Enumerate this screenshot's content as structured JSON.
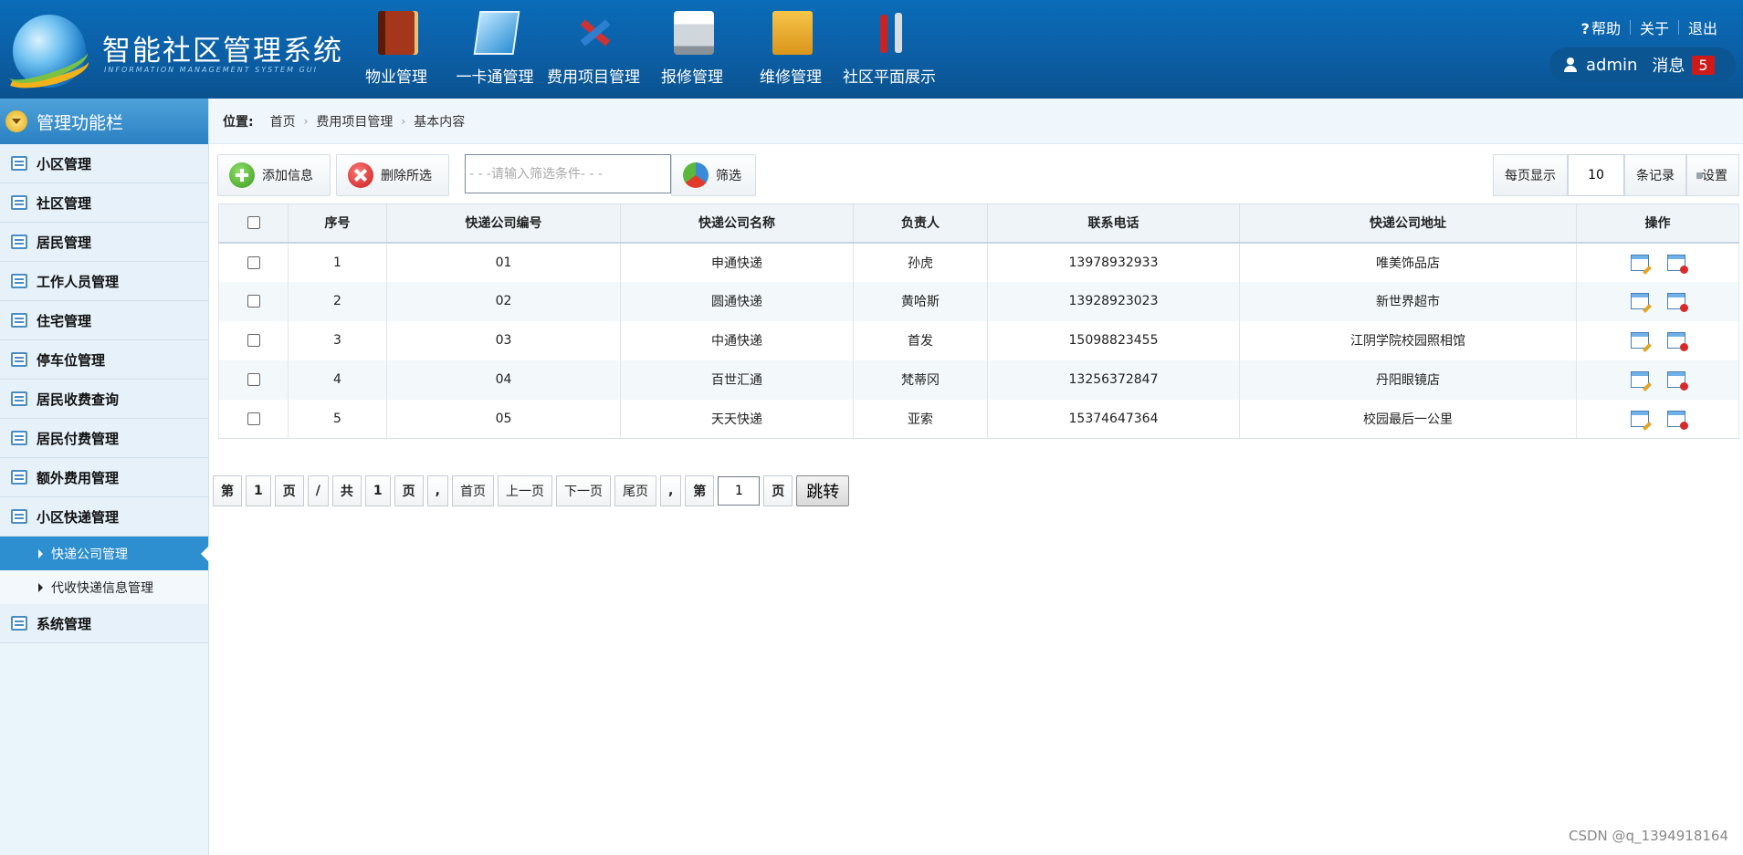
{
  "header": {
    "app_title": "智能社区管理系统",
    "app_subtitle": "INFORMATION MANAGEMENT SYSTEM GUI",
    "nav": [
      {
        "label": "物业管理",
        "icon": "book-icon"
      },
      {
        "label": "一卡通管理",
        "icon": "card-icon"
      },
      {
        "label": "费用项目管理",
        "icon": "tools-icon"
      },
      {
        "label": "报修管理",
        "icon": "printer-icon"
      },
      {
        "label": "维修管理",
        "icon": "folder-icon"
      },
      {
        "label": "社区平面展示",
        "icon": "wrench-icon"
      }
    ],
    "links": {
      "help": "帮助",
      "about": "关于",
      "logout": "退出"
    },
    "user": {
      "name": "admin",
      "messages_label": "消息",
      "message_count": "5"
    }
  },
  "sidebar": {
    "title": "管理功能栏",
    "items": [
      {
        "label": "小区管理"
      },
      {
        "label": "社区管理"
      },
      {
        "label": "居民管理"
      },
      {
        "label": "工作人员管理"
      },
      {
        "label": "住宅管理"
      },
      {
        "label": "停车位管理"
      },
      {
        "label": "居民收费查询"
      },
      {
        "label": "居民付费管理"
      },
      {
        "label": "额外费用管理"
      },
      {
        "label": "小区快递管理"
      }
    ],
    "sub_items": [
      {
        "label": "快递公司管理",
        "active": true
      },
      {
        "label": "代收快递信息管理",
        "active": false
      }
    ],
    "last_item": {
      "label": "系统管理"
    }
  },
  "breadcrumb": {
    "label": "位置:",
    "items": [
      "首页",
      "费用项目管理",
      "基本内容"
    ]
  },
  "toolbar": {
    "add_label": "添加信息",
    "delete_label": "删除所选",
    "search_placeholder": "- - -请输入筛选条件- - -",
    "filter_label": "筛选",
    "per_page_label": "每页显示",
    "per_page_value": "10",
    "records_label": "条记录",
    "settings_label": "设置"
  },
  "table": {
    "headers": [
      "序号",
      "快递公司编号",
      "快递公司名称",
      "负责人",
      "联系电话",
      "快递公司地址",
      "操作"
    ],
    "rows": [
      {
        "no": "1",
        "code": "01",
        "name": "申通快递",
        "manager": "孙虎",
        "phone": "13978932933",
        "address": "唯美饰品店"
      },
      {
        "no": "2",
        "code": "02",
        "name": "圆通快递",
        "manager": "黄哈斯",
        "phone": "13928923023",
        "address": "新世界超市"
      },
      {
        "no": "3",
        "code": "03",
        "name": "中通快递",
        "manager": "首发",
        "phone": "15098823455",
        "address": "江阴学院校园照相馆"
      },
      {
        "no": "4",
        "code": "04",
        "name": "百世汇通",
        "manager": "梵蒂冈",
        "phone": "13256372847",
        "address": "丹阳眼镜店"
      },
      {
        "no": "5",
        "code": "05",
        "name": "天天快递",
        "manager": "亚索",
        "phone": "15374647364",
        "address": "校园最后一公里"
      }
    ]
  },
  "pager": {
    "items": [
      "第",
      "1",
      "页",
      "/",
      "共",
      "1",
      "页",
      ",",
      "首页",
      "上一页",
      "下一页",
      "尾页",
      ",",
      "第"
    ],
    "page_input": "1",
    "page_suffix": "页",
    "go_label": "跳转"
  },
  "watermark": "CSDN @q_1394918164"
}
